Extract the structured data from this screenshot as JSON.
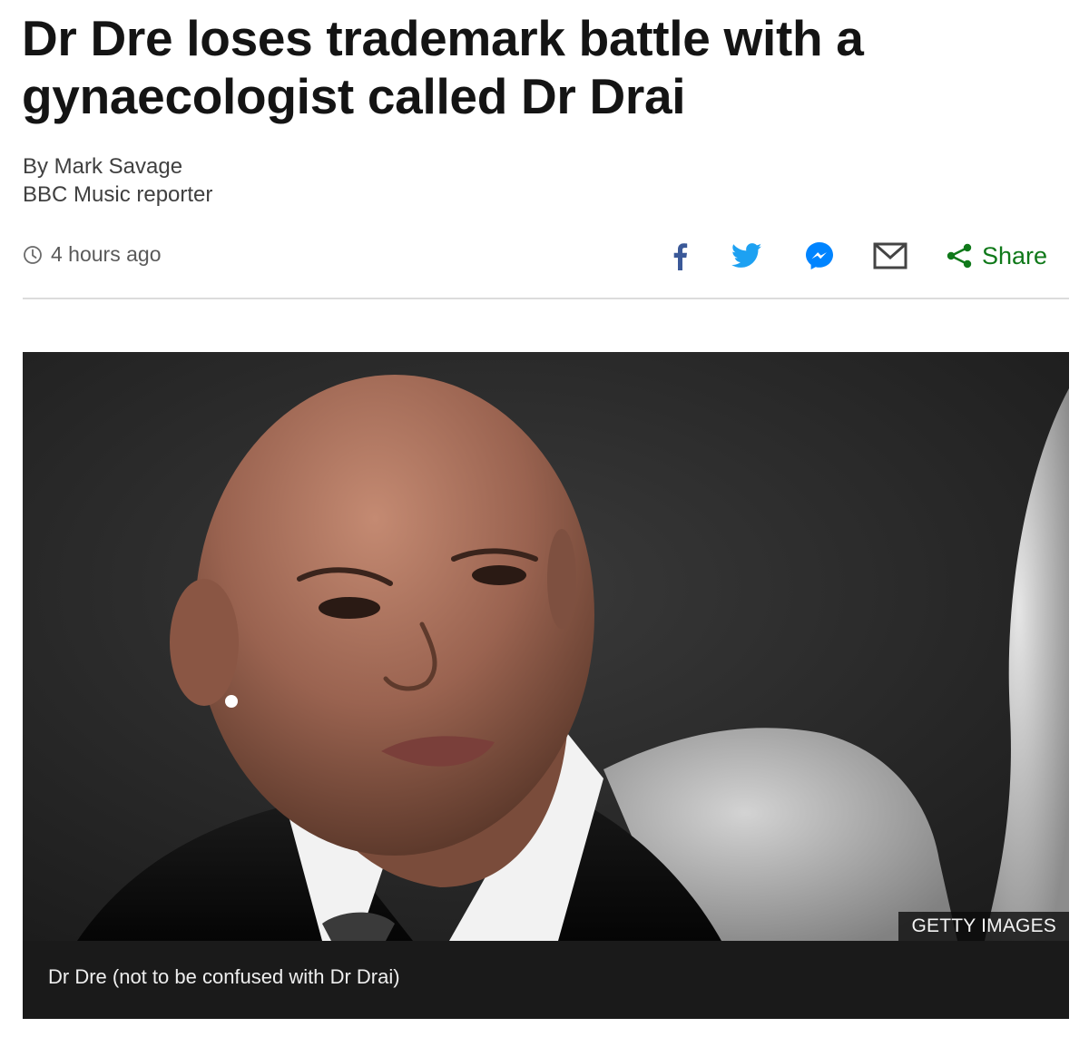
{
  "article": {
    "headline": "Dr Dre loses trademark battle with a gynaecologist called Dr Drai",
    "byline": {
      "author": "By Mark Savage",
      "role": "BBC Music reporter"
    },
    "timestamp": "4 hours ago",
    "share": {
      "label": "Share",
      "icons": [
        "facebook-icon",
        "twitter-icon",
        "messenger-icon",
        "email-icon",
        "share-icon"
      ],
      "colors": {
        "facebook": "#3b5998",
        "twitter": "#1da1f2",
        "messenger": "#0084ff",
        "email": "#444444",
        "share": "#10791a"
      }
    },
    "image": {
      "credit": "GETTY IMAGES",
      "caption": "Dr Dre (not to be confused with Dr Drai)"
    }
  }
}
